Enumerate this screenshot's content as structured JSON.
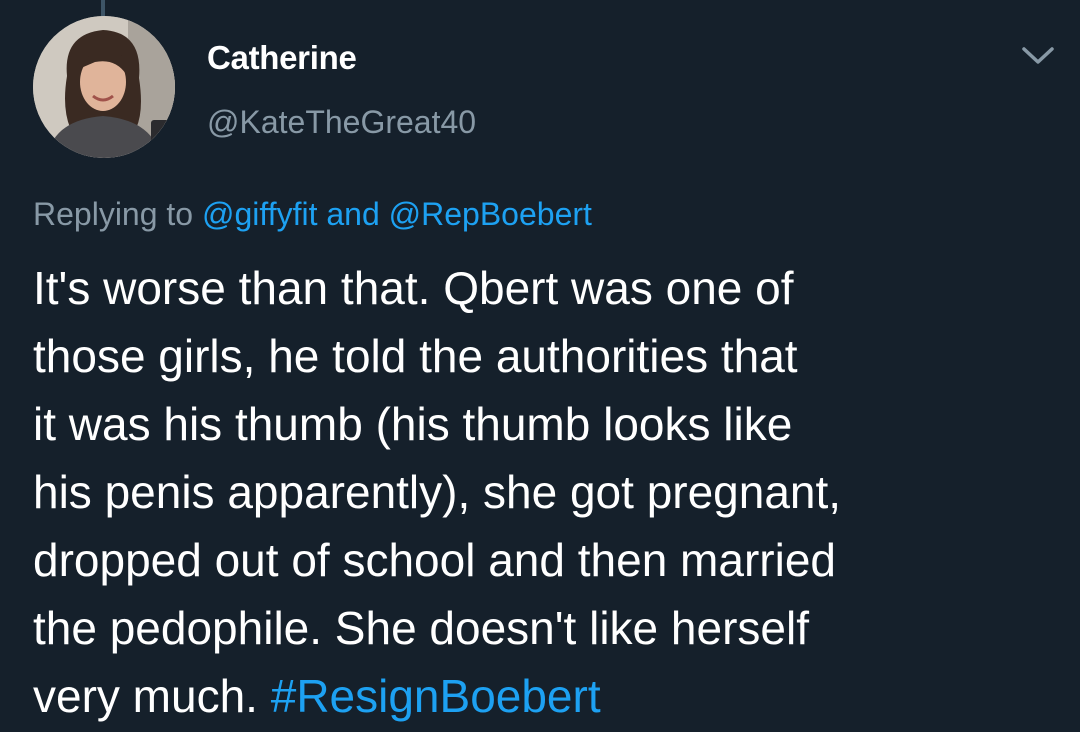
{
  "author": {
    "display_name": "Catherine",
    "handle": "@KateTheGreat40"
  },
  "reply_context": {
    "prefix": "Replying to ",
    "mention_1": "@giffyfit",
    "joiner": " and ",
    "mention_2": "@RepBoebert"
  },
  "tweet": {
    "lines": [
      "It's worse than that. Qbert was one of",
      "those girls, he told the authorities that",
      "it was his thumb (his thumb looks like",
      "his penis apparently), she got pregnant,",
      "dropped out of school and then married",
      "the pedophile. She doesn't like herself"
    ],
    "last_line_text": "very much. ",
    "hashtag": "#ResignBoebert"
  },
  "icons": {
    "menu": "chevron-down-icon",
    "avatar": "profile-photo"
  },
  "colors": {
    "background": "#15202b",
    "primary_text": "#ffffff",
    "secondary_text": "#8899a6",
    "link": "#1da1f2",
    "thread_line": "#3d5466"
  }
}
